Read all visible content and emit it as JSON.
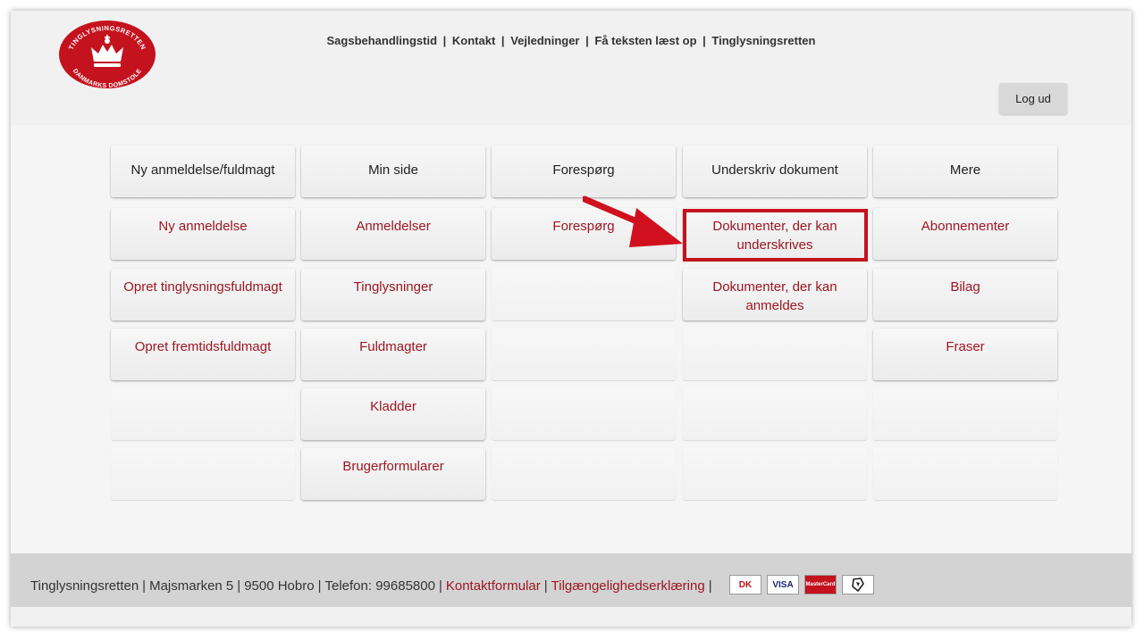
{
  "header": {
    "logo": {
      "top_text": "TINGLYSNINGSRETTEN",
      "bottom_text": "DANMARKS DOMSTOLE",
      "color": "#c4121e"
    },
    "nav_links": [
      "Sagsbehandlingstid",
      "Kontakt",
      "Vejledninger",
      "Få teksten læst op",
      "Tinglysningsretten"
    ],
    "nav_separator": "|",
    "logout_label": "Log ud"
  },
  "menu": {
    "columns": [
      {
        "items": [
          "Ny anmeldelse/fuldmagt",
          "Ny anmeldelse",
          "Opret tinglysningsfuldmagt",
          "Opret fremtidsfuldmagt",
          "",
          ""
        ]
      },
      {
        "items": [
          "Min side",
          "Anmeldelser",
          "Tinglysninger",
          "Fuldmagter",
          "Kladder",
          "Brugerformularer"
        ]
      },
      {
        "items": [
          "Forespørg",
          "Forespørg",
          "",
          "",
          "",
          ""
        ]
      },
      {
        "items": [
          "Underskriv dokument",
          "Dokumenter, der kan underskrives",
          "Dokumenter, der kan anmeldes",
          "",
          "",
          ""
        ]
      },
      {
        "items": [
          "Mere",
          "Abonnementer",
          "Bilag",
          "Fraser",
          "",
          ""
        ]
      }
    ]
  },
  "annotation": {
    "arrow_color": "#d0101e",
    "highlight_color": "#c4121e"
  },
  "footer": {
    "address_parts": [
      "Tinglysningsretten",
      "Majsmarken 5",
      "9500 Hobro",
      "Telefon: 99685800"
    ],
    "links": [
      "Kontaktformular",
      "Tilgængelighedserklæring"
    ],
    "separator": "|",
    "payment_icons": [
      "dankort-icon",
      "visa-icon",
      "mastercard-icon",
      "nemid-icon"
    ],
    "card_labels": {
      "dankort": "DK",
      "visa": "VISA",
      "mastercard": "MasterCard"
    }
  },
  "colors": {
    "accent": "#9e1622",
    "tile_bg": "#efefef",
    "footer_bg": "#d3d3d3"
  }
}
